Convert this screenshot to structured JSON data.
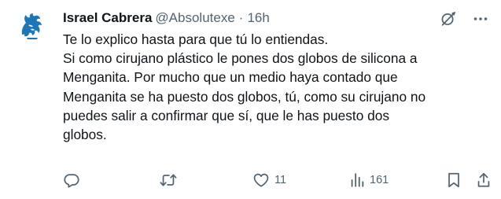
{
  "author": {
    "display_name": "Israel Cabrera",
    "handle": "@Absolutexe",
    "separator": "·",
    "time": "16h"
  },
  "top_actions": {
    "grok_icon": "grok-icon",
    "more_icon": "more-icon"
  },
  "tweet": {
    "lines": [
      "Te lo explico hasta para que tú lo entiendas.",
      "Si como cirujano plástico le pones dos globos de silicona a",
      "Menganita. Por mucho que un medio haya contado que",
      "Menganita se ha puesto dos globos, tú, como su cirujano no",
      "puedes salir a confirmar que sí, que le has puesto dos",
      "globos."
    ]
  },
  "stats": {
    "replies": "",
    "reposts": "",
    "likes": "11",
    "views": "161"
  },
  "colors": {
    "text": "#0f1419",
    "secondary": "#536471",
    "avatar_blue": "#1a78b8"
  }
}
